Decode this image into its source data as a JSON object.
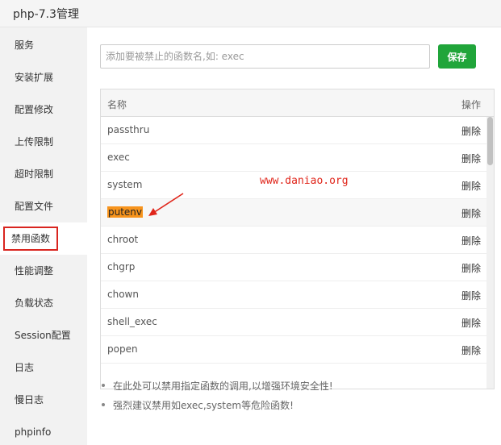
{
  "window": {
    "title": "php-7.3管理"
  },
  "sidebar": {
    "items": [
      {
        "label": "服务"
      },
      {
        "label": "安装扩展"
      },
      {
        "label": "配置修改"
      },
      {
        "label": "上传限制"
      },
      {
        "label": "超时限制"
      },
      {
        "label": "配置文件"
      },
      {
        "label": "禁用函数",
        "active": true
      },
      {
        "label": "性能调整"
      },
      {
        "label": "负载状态"
      },
      {
        "label": "Session配置"
      },
      {
        "label": "日志"
      },
      {
        "label": "慢日志"
      },
      {
        "label": "phpinfo"
      }
    ]
  },
  "form": {
    "placeholder": "添加要被禁止的函数名,如: exec",
    "save_label": "保存"
  },
  "table": {
    "headers": {
      "name": "名称",
      "op": "操作"
    },
    "rows": [
      {
        "name": "passthru",
        "action": "删除"
      },
      {
        "name": "exec",
        "action": "删除"
      },
      {
        "name": "system",
        "action": "删除"
      },
      {
        "name": "putenv",
        "action": "删除",
        "highlighted": true
      },
      {
        "name": "chroot",
        "action": "删除"
      },
      {
        "name": "chgrp",
        "action": "删除"
      },
      {
        "name": "chown",
        "action": "删除"
      },
      {
        "name": "shell_exec",
        "action": "删除"
      },
      {
        "name": "popen",
        "action": "删除"
      }
    ]
  },
  "watermark": "www.daniao.org",
  "tips": [
    "在此处可以禁用指定函数的调用,以增强环境安全性!",
    "强烈建议禁用如exec,system等危险函数!"
  ],
  "colors": {
    "accent": "#20a53a",
    "highlight": "#f7941d",
    "annotation": "#e0251a"
  }
}
